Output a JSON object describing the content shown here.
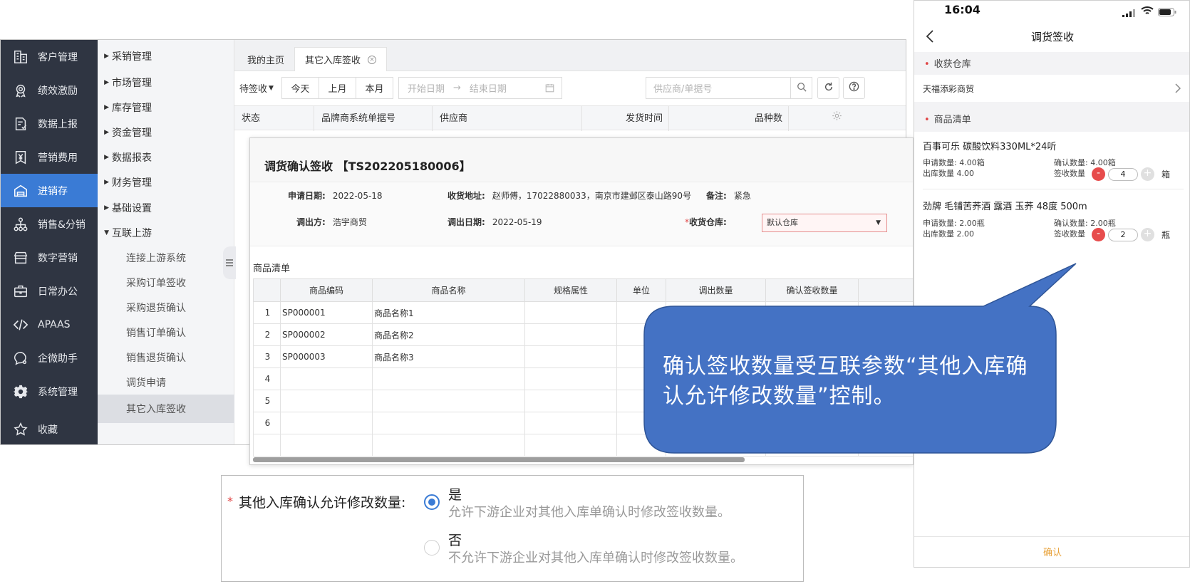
{
  "sidebar": {
    "items": [
      {
        "label": "客户管理",
        "icon": "building-icon"
      },
      {
        "label": "绩效激励",
        "icon": "medal-icon"
      },
      {
        "label": "数据上报",
        "icon": "report-icon"
      },
      {
        "label": "营销费用",
        "icon": "yen-icon"
      },
      {
        "label": "进销存",
        "icon": "warehouse-icon"
      },
      {
        "label": "销售&分销",
        "icon": "hierarchy-icon"
      },
      {
        "label": "数字营销",
        "icon": "store-icon"
      },
      {
        "label": "日常办公",
        "icon": "briefcase-icon"
      },
      {
        "label": "APAAS",
        "icon": "code-icon"
      },
      {
        "label": "企微助手",
        "icon": "chat-icon"
      },
      {
        "label": "系统管理",
        "icon": "gear-icon"
      },
      {
        "label": "收藏",
        "icon": "star-icon"
      }
    ],
    "active_index": 4
  },
  "subnav": {
    "groups": [
      "采销管理",
      "市场管理",
      "库存管理",
      "资金管理",
      "数据报表",
      "财务管理",
      "基础设置"
    ],
    "expanded": "互联上游",
    "children": [
      "连接上游系统",
      "采购订单签收",
      "采购退货确认",
      "销售订单确认",
      "销售退货确认",
      "调货申请",
      "其它入库签收"
    ],
    "active_child": "其它入库签收"
  },
  "tabs": [
    {
      "label": "我的主页"
    },
    {
      "label": "其它入库签收"
    }
  ],
  "filters": {
    "status": "待签收",
    "today": "今天",
    "last_month": "上月",
    "this_month": "本月",
    "start_placeholder": "开始日期",
    "arrow": "→",
    "end_placeholder": "结束日期",
    "search_placeholder": "供应商/单据号"
  },
  "list_columns": [
    "状态",
    "品牌商系统单据号",
    "供应商",
    "发货时间",
    "品种数"
  ],
  "modal": {
    "title": "调货确认签收 【TS202205180006】",
    "apply_date_label": "申请日期:",
    "apply_date": "2022-05-18",
    "address_label": "收货地址:",
    "address": "赵师傅，17022880033，南京市建邺区泰山路90号",
    "remark_label": "备注:",
    "remark": "紧急",
    "out_party_label": "调出方:",
    "out_party": "浩宇商贸",
    "out_date_label": "调出日期:",
    "out_date": "2022-05-19",
    "warehouse_required": "*",
    "warehouse_label": "收货仓库:",
    "warehouse": "默认仓库",
    "goods_title": "商品清单",
    "columns": [
      "",
      "商品编码",
      "商品名称",
      "规格属性",
      "单位",
      "调出数量",
      "确认签收数量"
    ],
    "rows": [
      {
        "no": "1",
        "code": "SP000001",
        "name": "商品名称1"
      },
      {
        "no": "2",
        "code": "SP000002",
        "name": "商品名称2"
      },
      {
        "no": "3",
        "code": "SP000003",
        "name": "商品名称3"
      },
      {
        "no": "4",
        "code": "",
        "name": ""
      },
      {
        "no": "5",
        "code": "",
        "name": ""
      },
      {
        "no": "6",
        "code": "",
        "name": ""
      },
      {
        "no": "",
        "code": "",
        "name": ""
      }
    ]
  },
  "callout": {
    "line1": "确认签收数量受互联参数“其他入库确",
    "line2": "认允许修改数量”控制。",
    "color": "#4472c4"
  },
  "phone": {
    "time": "16:04",
    "title": "调货签收",
    "warehouse_label": "收获仓库",
    "warehouse_value": "天福添彩商贸",
    "goods_label": "商品清单",
    "items": [
      {
        "name": "百事可乐 碳酸饮料330ML*24听",
        "apply_qty": "申请数量:  4.00箱",
        "confirm_qty": "确认数量:  4.00箱",
        "out_qty": "出库数量  4.00",
        "sign_label": "签收数量",
        "sign_value": "4",
        "unit": "箱"
      },
      {
        "name": "劲牌 毛铺苦荞酒 露酒 玉荞 48度 500m",
        "apply_qty": "申请数量:  2.00瓶",
        "confirm_qty": "确认数量:  2.00瓶",
        "out_qty": "出库数量  2.00",
        "sign_label": "签收数量",
        "sign_value": "2",
        "unit": "瓶"
      }
    ],
    "confirm": "确认",
    "minus": "-",
    "plus": "+"
  },
  "param": {
    "required": "*",
    "label": "其他入库确认允许修改数量:",
    "yes": "是",
    "yes_desc": "允许下游企业对其他入库单确认时修改签收数量。",
    "no": "否",
    "no_desc": "不允许下游企业对其他入库单确认时修改签收数量。",
    "selected": "yes"
  }
}
